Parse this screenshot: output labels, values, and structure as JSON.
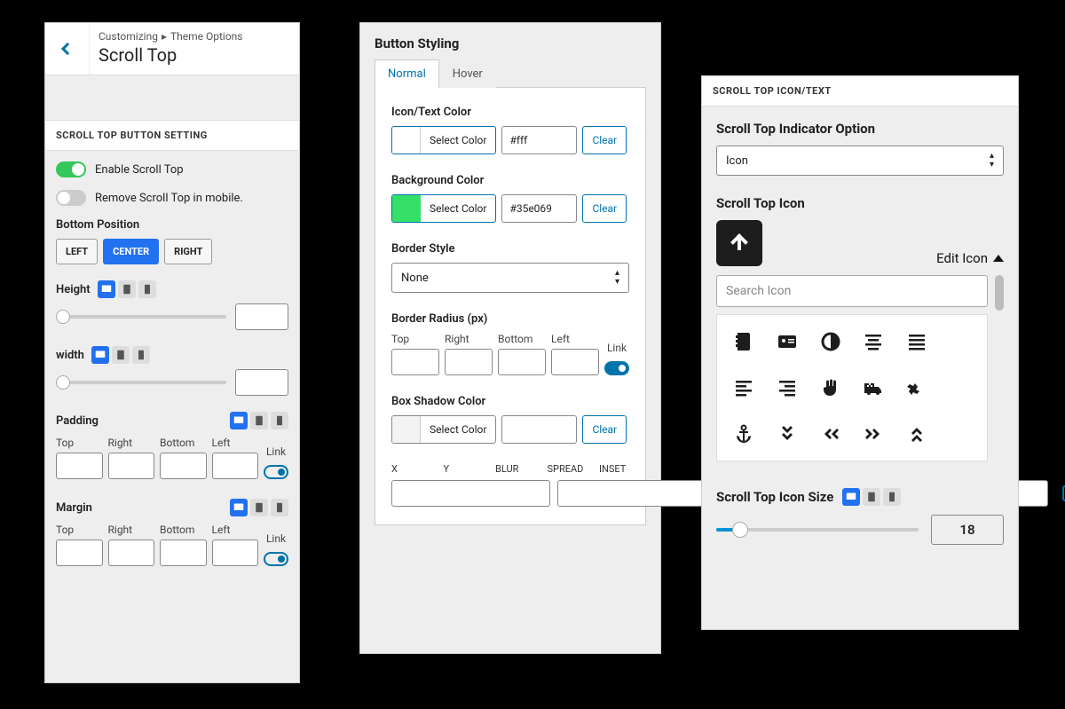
{
  "panel1": {
    "breadcrumb": {
      "parent": "Customizing",
      "child": "Theme Options"
    },
    "title": "Scroll Top",
    "section_title": "SCROLL TOP BUTTON SETTING",
    "enable_label": "Enable Scroll Top",
    "remove_mobile_label": "Remove Scroll Top in mobile.",
    "bottom_position": {
      "label": "Bottom Position",
      "options": {
        "left": "LEFT",
        "center": "CENTER",
        "right": "RIGHT"
      }
    },
    "height_label": "Height",
    "width_label": "width",
    "padding_label": "Padding",
    "margin_label": "Margin",
    "sides": {
      "top": "Top",
      "right": "Right",
      "bottom": "Bottom",
      "left": "Left",
      "link": "Link"
    }
  },
  "panel2": {
    "title": "Button Styling",
    "tabs": {
      "normal": "Normal",
      "hover": "Hover"
    },
    "icon_text_color": {
      "label": "Icon/Text Color",
      "select": "Select Color",
      "hex": "#fff"
    },
    "bg_color": {
      "label": "Background Color",
      "select": "Select Color",
      "hex": "#35e069",
      "swatch": "#35e069"
    },
    "border_style": {
      "label": "Border Style",
      "value": "None"
    },
    "border_radius": {
      "label": "Border Radius (px)"
    },
    "box_shadow": {
      "label": "Box Shadow Color",
      "select": "Select Color"
    },
    "clear": "Clear",
    "sides": {
      "top": "Top",
      "right": "Right",
      "bottom": "Bottom",
      "left": "Left",
      "link": "Link"
    },
    "shadow_labels": {
      "x": "X",
      "y": "Y",
      "blur": "BLUR",
      "spread": "SPREAD",
      "inset": "INSET"
    }
  },
  "panel3": {
    "section_title": "SCROLL TOP ICON/TEXT",
    "indicator": {
      "label": "Scroll Top Indicator Option",
      "value": "Icon"
    },
    "icon_label": "Scroll Top Icon",
    "edit_icon": "Edit Icon",
    "search_placeholder": "Search Icon",
    "size": {
      "label": "Scroll Top Icon Size",
      "value": "18"
    }
  }
}
